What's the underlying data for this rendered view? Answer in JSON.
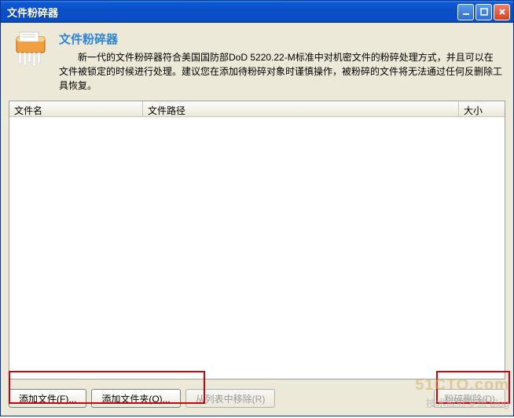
{
  "titlebar": {
    "title": "文件粉碎器"
  },
  "header": {
    "title": "文件粉碎器",
    "description": "新一代的文件粉碎器符合美国国防部DoD 5220.22-M标准中对机密文件的粉碎处理方式，并且可以在文件被锁定的时候进行处理。建议您在添加待粉碎对象时谨慎操作，被粉碎的文件将无法通过任何反删除工具恢复。"
  },
  "columns": {
    "name": "文件名",
    "path": "文件路径",
    "size": "大小"
  },
  "buttons": {
    "add_file": "添加文件(F)...",
    "add_folder": "添加文件夹(O)...",
    "remove": "从列表中移除(R)",
    "shred": "粉碎删除(D)"
  },
  "watermark": {
    "line1": "51CTO.com",
    "line2": "技术成就梦想 blog"
  }
}
